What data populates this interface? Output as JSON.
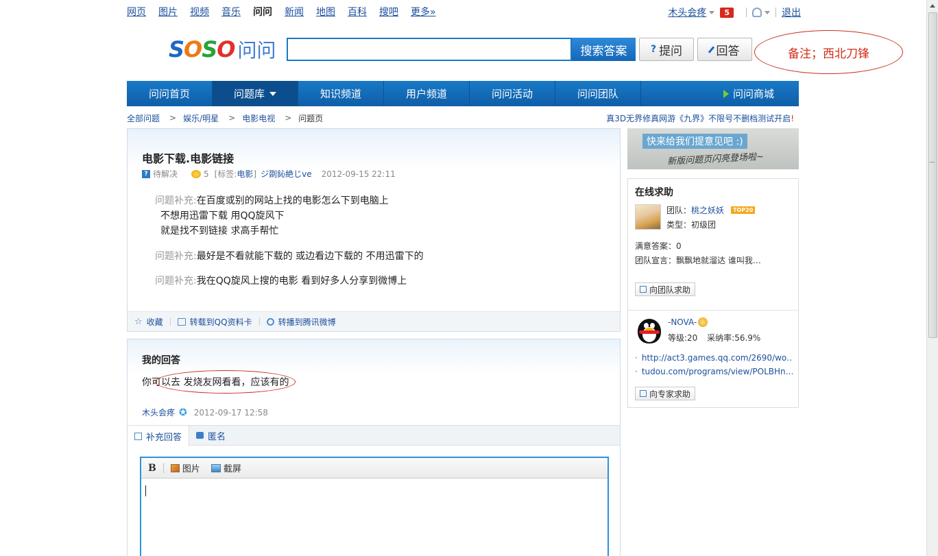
{
  "topnav": {
    "links": [
      "网页",
      "图片",
      "视频",
      "音乐",
      "问问",
      "新闻",
      "地图",
      "百科",
      "搜吧",
      "更多»"
    ],
    "active_index": 4
  },
  "user": {
    "name": "木头会疼",
    "message_count": "5",
    "logout": "退出"
  },
  "logo": {
    "text1": "SOSO",
    "text2": "问问"
  },
  "search": {
    "value": "",
    "button": "搜索答案"
  },
  "actions": {
    "ask": "提问",
    "answer": "回答"
  },
  "annotation_note": "备注；西北刀锋",
  "nav": {
    "items": [
      "问问首页",
      "问题库",
      "知识频道",
      "用户频道",
      "问问活动",
      "问问团队"
    ],
    "active": "问题库",
    "mall": "问问商城"
  },
  "breadcrumb": [
    "全部问题",
    "娱乐/明星",
    "电影电视",
    "问题页"
  ],
  "promo": {
    "text": "真3D无界修真网游《九界》不限号不删档测试开启",
    "exclaim": "!"
  },
  "question": {
    "title": "电影下载.电影链接",
    "status": "待解决",
    "reward": "5",
    "tag_label": "[标签:",
    "tag": "电影",
    "tag_close": "]",
    "author": "ジ剟鈊絶じve",
    "time": "2012-09-15 22:11",
    "supplements": [
      {
        "label": "问题补充:",
        "lines": [
          "在百度或别的网站上找的电影怎么下到电脑上",
          "不想用迅雷下载  用QQ旋风下",
          "就是找不到链接  求高手帮忙"
        ]
      },
      {
        "label": "问题补充:",
        "lines": [
          "最好是不看就能下载的  或边看边下载的  不用迅雷下的"
        ]
      },
      {
        "label": "问题补充:",
        "lines": [
          "我在QQ旋风上搜的电影  看到好多人分享到微博上"
        ]
      }
    ],
    "bottom_actions": [
      "收藏",
      "转载到QQ资料卡",
      "转播到腾讯微博"
    ]
  },
  "my_answer": {
    "title": "我的回答",
    "text": "你可以去  发烧友网看看，应该有的",
    "user": "木头会疼",
    "time": "2012-09-17 12:58",
    "tabs": [
      "补充回答",
      "匿名"
    ],
    "editor_tools": {
      "bold": "B",
      "image": "图片",
      "screenshot": "截屏"
    }
  },
  "feedback_banner": {
    "line1": "快来给我们提意见吧 :)",
    "line2": "新版问题页闪亮登场啦~"
  },
  "online_help": {
    "title": "在线求助",
    "team_label": "团队：",
    "team_name": "桃之妖妖",
    "top_badge": "TOP20",
    "type_label": "类型：",
    "type_value": "初级团",
    "satisfied_label": "满意答案：",
    "satisfied_value": "0",
    "motto_label": "团队宣言：",
    "motto_value": "飘飘地就溜达  谁叫我…",
    "team_button": "向团队求助",
    "expert_name": "-NOVA-",
    "expert_level_label": "等级:",
    "expert_level": "20",
    "expert_rate_label": "采纳率:",
    "expert_rate": "56.9%",
    "links": [
      "http://act3.games.qq.com/2690/wo…",
      "tudou.com/programs/view/POLBHn…"
    ],
    "expert_button": "向专家求助"
  }
}
